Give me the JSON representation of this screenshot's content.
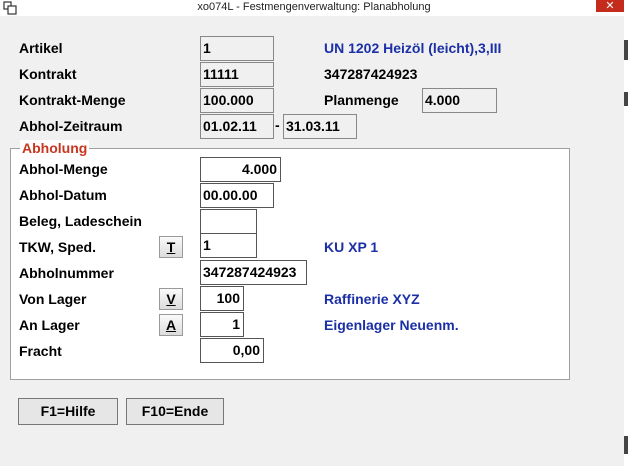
{
  "window": {
    "title": "xo074L - Festmengenverwaltung: Planabholung",
    "close_label": "✕"
  },
  "header": {
    "artikel": {
      "label": "Artikel",
      "value": "1",
      "description": "UN 1202 Heizöl (leicht),3,III"
    },
    "kontrakt": {
      "label": "Kontrakt",
      "value": "11111",
      "description": "347287424923"
    },
    "kontrakt_menge": {
      "label": "Kontrakt-Menge",
      "value": "100.000",
      "planmenge_label": "Planmenge",
      "planmenge_value": "4.000"
    },
    "abhol_zeitraum": {
      "label": "Abhol-Zeitraum",
      "from": "01.02.11",
      "separator": "-",
      "to": "31.03.11"
    }
  },
  "abholung": {
    "title": "Abholung",
    "abhol_menge": {
      "label": "Abhol-Menge",
      "value": "4.000"
    },
    "abhol_datum": {
      "label": "Abhol-Datum",
      "value": "00.00.00"
    },
    "beleg": {
      "label": "Beleg, Ladeschein",
      "value": ""
    },
    "tkw": {
      "label": "TKW, Sped.",
      "button": "T",
      "value": "1",
      "description": "KU XP 1"
    },
    "abholnummer": {
      "label": "Abholnummer",
      "value": "347287424923"
    },
    "von_lager": {
      "label": "Von Lager",
      "button": "V",
      "value": "100",
      "description": "Raffinerie XYZ"
    },
    "an_lager": {
      "label": "An Lager",
      "button": "A",
      "value": "1",
      "description": "Eigenlager Neuenm."
    },
    "fracht": {
      "label": "Fracht",
      "value": "0,00"
    }
  },
  "footer": {
    "help_label": "F1=Hilfe",
    "end_label": "F10=Ende"
  },
  "colors": {
    "accent_blue": "#1b2fa6",
    "group_title": "#c8361f",
    "close_red": "#c42b1c"
  }
}
